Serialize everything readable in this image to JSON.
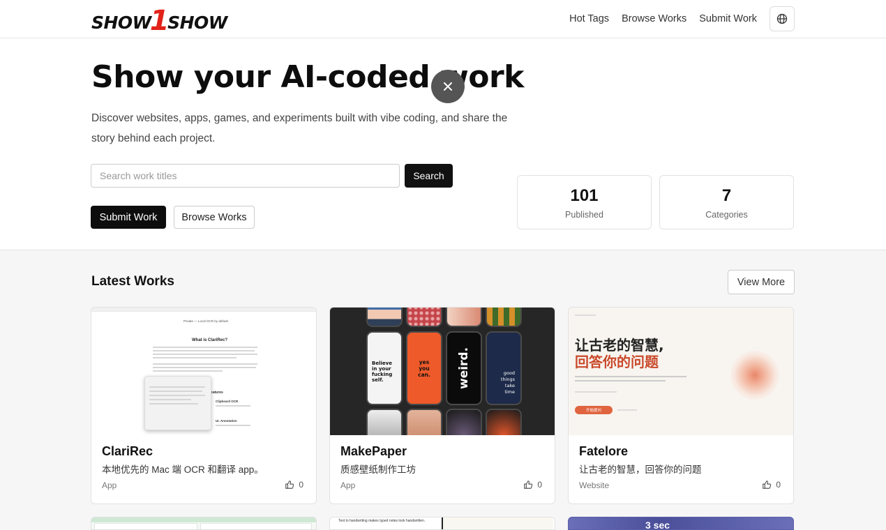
{
  "header": {
    "logo_text_left": "SHOW",
    "logo_digit": "1",
    "logo_text_right": "SHOW",
    "nav": [
      "Hot Tags",
      "Browse Works",
      "Submit Work"
    ],
    "language_icon": "globe-icon"
  },
  "overlay": {
    "close_icon": "close-icon"
  },
  "hero": {
    "title": "Show your AI-coded work",
    "description": "Discover websites, apps, games, and experiments built with vibe coding, and share the story behind each project.",
    "search_placeholder": "Search work titles",
    "search_value": "",
    "search_label": "Search",
    "submit_label": "Submit Work",
    "browse_label": "Browse Works",
    "stats": [
      {
        "value": "101",
        "label": "Published"
      },
      {
        "value": "7",
        "label": "Categories"
      }
    ]
  },
  "latest": {
    "title": "Latest Works",
    "view_more": "View More",
    "cards": [
      {
        "title": "ClariRec",
        "subtitle": "本地优先的 Mac 端 OCR 和翻译 app。",
        "category": "App",
        "likes": "0",
        "thumb": {
          "banner": "Private — Local OCR by default",
          "heading": "What is ClariRec?",
          "side_label": "Features",
          "item1": "Clipboard OCR",
          "item2": "UI. Annotation"
        }
      },
      {
        "title": "MakePaper",
        "subtitle": "质感壁纸制作工坊",
        "category": "App",
        "likes": "0",
        "thumb": {
          "phone1": "Believe in your fucking self.",
          "phone2": "yes you can.",
          "phone3": "weird.",
          "phone4": "good things take time"
        }
      },
      {
        "title": "Fatelore",
        "subtitle": "让古老的智慧，回答你的问题",
        "category": "Website",
        "likes": "0",
        "thumb": {
          "line1": "让古老的智慧,",
          "line2": "回答你的问题",
          "cta": "开始提问"
        }
      }
    ],
    "row2_thumbs": [
      {
        "text": ""
      },
      {
        "text": "Text to handwriting makes typed notes look handwritten."
      },
      {
        "text": "3 sec"
      }
    ]
  },
  "colors": {
    "brand_red": "#e2231a",
    "primary_button": "#0d0d0d",
    "accent_orange": "#e0643f"
  }
}
